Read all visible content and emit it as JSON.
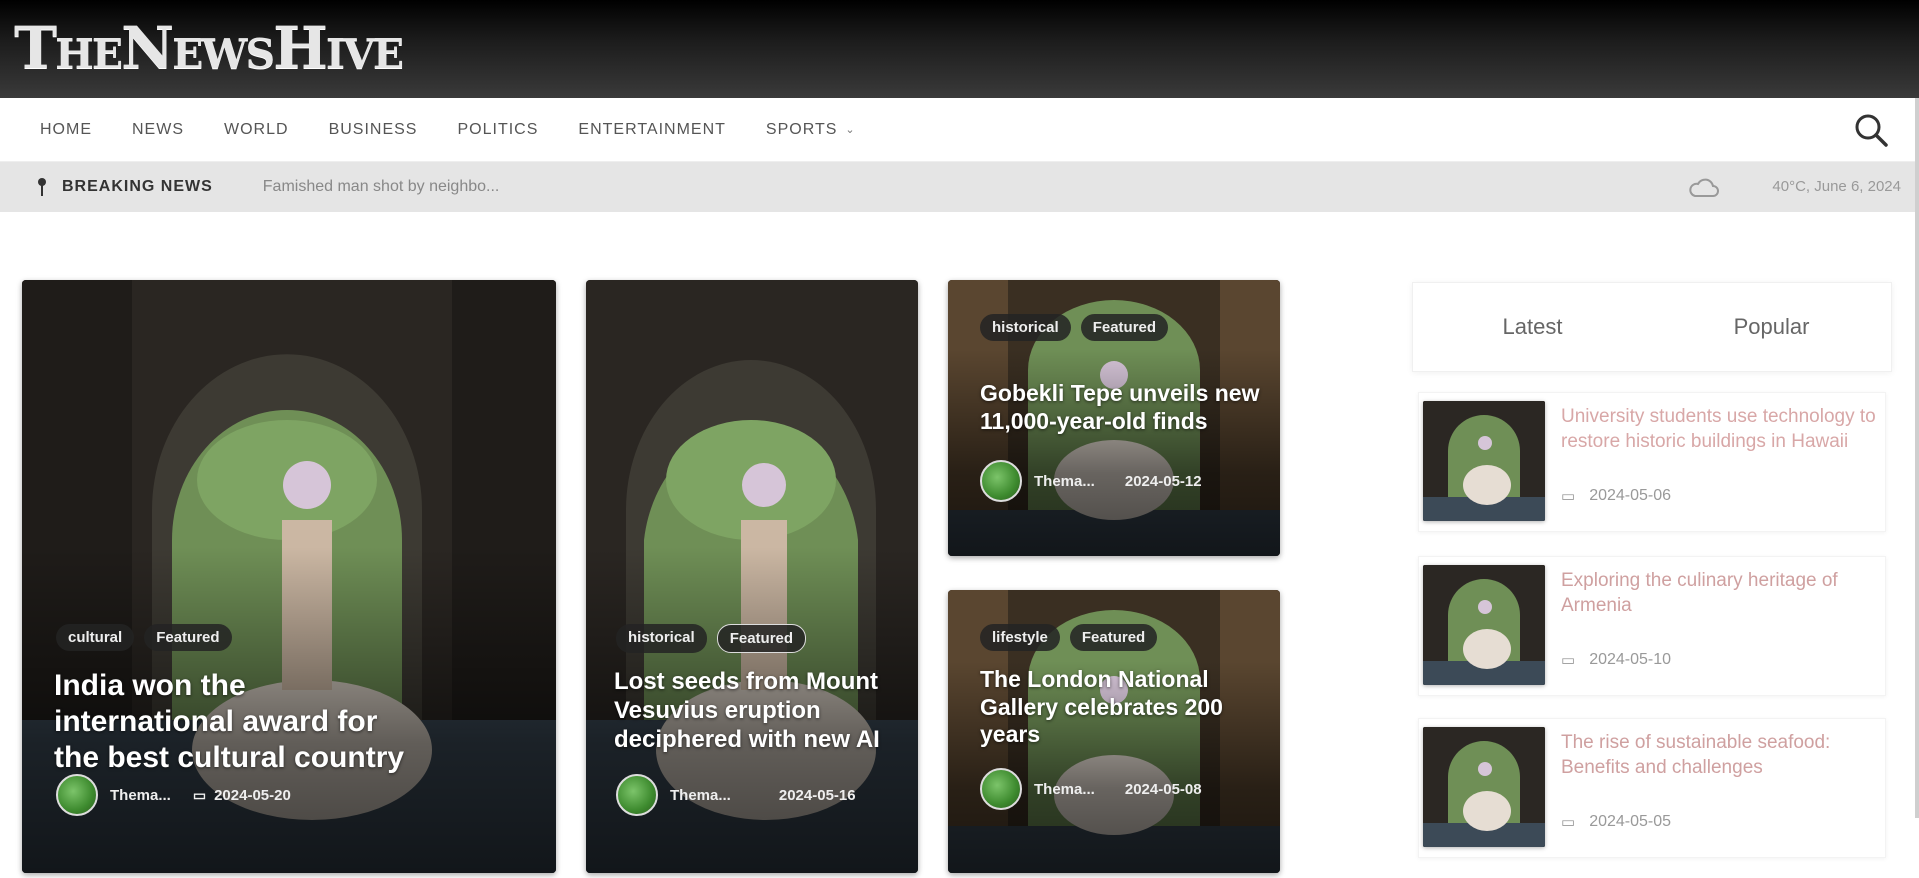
{
  "header": {
    "logo": "TheNewsHive"
  },
  "nav": {
    "items": [
      "HOME",
      "NEWS",
      "WORLD",
      "BUSINESS",
      "POLITICS",
      "ENTERTAINMENT",
      "SPORTS"
    ],
    "sports_chevron": "⌄"
  },
  "breaking": {
    "label": "BREAKING NEWS",
    "headline": "Famished man shot by neighbo...",
    "weather": "40°C",
    "date": "June 6, 2024"
  },
  "cards": [
    {
      "tags": [
        "cultural",
        "Featured"
      ],
      "title": "India won the international award for the best cultural country",
      "author": "Thema...",
      "date": "2024-05-20"
    },
    {
      "tags": [
        "historical",
        "Featured"
      ],
      "title": "Lost seeds from Mount Vesuvius eruption deciphered with new AI",
      "author": "Thema...",
      "date": "2024-05-16"
    },
    {
      "tags": [
        "historical",
        "Featured"
      ],
      "title": "Gobekli Tepe unveils new 11,000-year-old finds",
      "author": "Thema...",
      "date": "2024-05-12"
    },
    {
      "tags": [
        "lifestyle",
        "Featured"
      ],
      "title": "The London National Gallery celebrates 200 years",
      "author": "Thema...",
      "date": "2024-05-08"
    }
  ],
  "sidebar": {
    "tabs": [
      "Latest",
      "Popular"
    ],
    "items": [
      {
        "title": "University students use technology to restore historic buildings in Hawaii",
        "date": "2024-05-06"
      },
      {
        "title": "Exploring the culinary heritage of Armenia",
        "date": "2024-05-10"
      },
      {
        "title": "The rise of sustainable seafood: Benefits and challenges",
        "date": "2024-05-05"
      }
    ]
  },
  "colors": {
    "header_dark": "#000000",
    "breaking_bg": "#e5e5e5",
    "sidebar_title": "#d8a7a7"
  },
  "icons": {
    "search": "search-icon",
    "pin": "pin-icon",
    "weather": "cloud-icon",
    "calendar": "calendar-icon"
  }
}
